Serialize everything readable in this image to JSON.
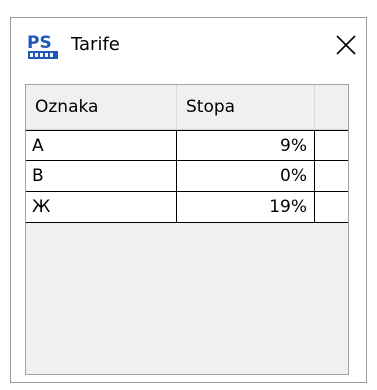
{
  "window": {
    "title": "Tarife",
    "icon": "ps-app-icon",
    "close_icon": "close-icon"
  },
  "table": {
    "columns": [
      "Oznaka",
      "Stopa",
      ""
    ],
    "rows": [
      {
        "oznaka": "A",
        "stopa": "9%"
      },
      {
        "oznaka": "B",
        "stopa": "0%"
      },
      {
        "oznaka": "Ж",
        "stopa": "19%"
      }
    ]
  }
}
